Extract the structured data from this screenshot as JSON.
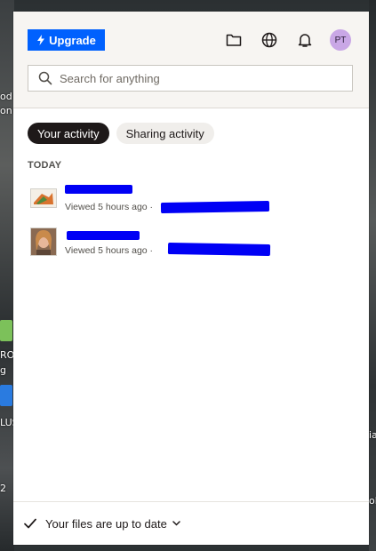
{
  "header": {
    "upgrade_label": "Upgrade",
    "avatar_initials": "PT"
  },
  "search": {
    "placeholder": "Search for anything"
  },
  "tabs": [
    {
      "label": "Your activity",
      "active": true
    },
    {
      "label": "Sharing activity",
      "active": false
    }
  ],
  "activity": {
    "section_label": "TODAY",
    "items": [
      {
        "meta": "Viewed 5 hours ago ·"
      },
      {
        "meta": "Viewed 5 hours ago ·"
      }
    ]
  },
  "footer": {
    "status_label": "Your files are up to date"
  },
  "desktop": {
    "labels": [
      "od",
      "on",
      "RO",
      "g",
      "LUS",
      "2",
      "ia",
      "ol"
    ]
  },
  "colors": {
    "accent": "#0061fe",
    "redaction": "#0000f5",
    "avatar_bg": "#c9a7e6"
  }
}
